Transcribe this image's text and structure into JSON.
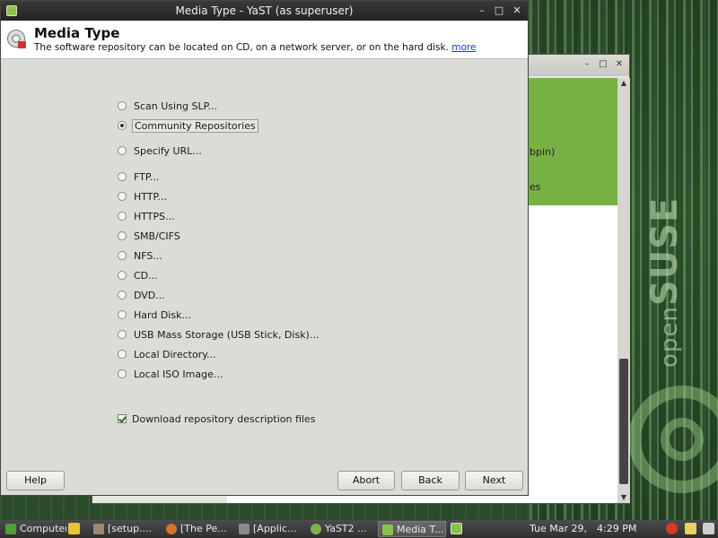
{
  "dialog": {
    "title": "Media Type - YaST (as superuser)",
    "header_title": "Media Type",
    "header_desc": "The software repository can be located on CD, on a network server, or on the hard disk.",
    "more_link": "more",
    "options": [
      {
        "label": "Scan Using SLP...",
        "selected": false
      },
      {
        "label": "Community Repositories",
        "selected": true
      },
      {
        "label": "Specify URL...",
        "selected": false
      },
      {
        "label": "FTP...",
        "selected": false
      },
      {
        "label": "HTTP...",
        "selected": false
      },
      {
        "label": "HTTPS...",
        "selected": false
      },
      {
        "label": "SMB/CIFS",
        "selected": false
      },
      {
        "label": "NFS...",
        "selected": false
      },
      {
        "label": "CD...",
        "selected": false
      },
      {
        "label": "DVD...",
        "selected": false
      },
      {
        "label": "Hard Disk...",
        "selected": false
      },
      {
        "label": "USB Mass Storage (USB Stick, Disk)...",
        "selected": false
      },
      {
        "label": "Local Directory...",
        "selected": false
      },
      {
        "label": "Local ISO Image...",
        "selected": false
      }
    ],
    "download_checkbox": {
      "label": "Download repository description files",
      "checked": true
    },
    "buttons": {
      "help": "Help",
      "abort": "Abort",
      "back": "Back",
      "next": "Next"
    }
  },
  "background_window": {
    "fragment_1": "bpin)",
    "fragment_2": "es"
  },
  "desktop": {
    "logo_open": "open",
    "logo_suse": "SUSE"
  },
  "taskbar": {
    "items": [
      "Computer",
      "[setup....",
      "[The Pe...",
      "[Applic...",
      "YaST2 ...",
      "Media T..."
    ],
    "clock_date": "Tue Mar 29,",
    "clock_time": "4:29 PM"
  },
  "colors": {
    "accent_green": "#77b043",
    "titlebar": "#2b2b2b",
    "link": "#1a3fbf"
  }
}
